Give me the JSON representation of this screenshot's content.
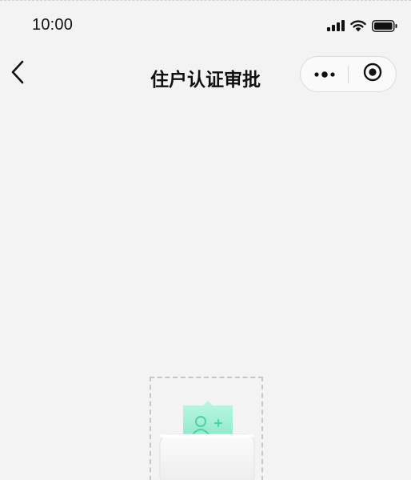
{
  "status_bar": {
    "time": "10:00",
    "icons": [
      "cellular-signal-icon",
      "wifi-icon",
      "battery-icon"
    ]
  },
  "nav_bar": {
    "title": "住户认证审批",
    "back_icon": "chevron-left-icon",
    "capsule_icons": [
      "more-dots-icon",
      "close-target-icon"
    ]
  },
  "empty_state": {
    "illustration_icon": "add-user-card-icon",
    "accent_color": "#7fe8c6"
  },
  "colors": {
    "background": "#f3f3f3",
    "text": "#111111"
  }
}
